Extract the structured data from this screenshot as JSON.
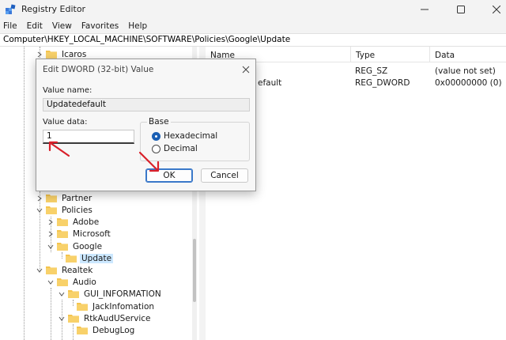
{
  "window": {
    "title": "Registry Editor",
    "icon": "registry-icon"
  },
  "menu": [
    "File",
    "Edit",
    "View",
    "Favorites",
    "Help"
  ],
  "address": "Computer\\HKEY_LOCAL_MACHINE\\SOFTWARE\\Policies\\Google\\Update",
  "tree": {
    "items": [
      {
        "label": "Icaros",
        "expander": "right",
        "selected": false
      },
      {
        "label": "Partner",
        "expander": "right",
        "selected": false
      },
      {
        "label": "Policies",
        "expander": "down",
        "selected": false
      },
      {
        "label": "Adobe",
        "expander": "right",
        "selected": false
      },
      {
        "label": "Microsoft",
        "expander": "right",
        "selected": false
      },
      {
        "label": "Google",
        "expander": "down",
        "selected": false
      },
      {
        "label": "Update",
        "expander": "none",
        "selected": true
      },
      {
        "label": "Realtek",
        "expander": "down",
        "selected": false
      },
      {
        "label": "Audio",
        "expander": "down",
        "selected": false
      },
      {
        "label": "GUI_INFORMATION",
        "expander": "down",
        "selected": false
      },
      {
        "label": "JackInfomation",
        "expander": "none",
        "selected": false
      },
      {
        "label": "RtkAudUService",
        "expander": "down",
        "selected": false
      },
      {
        "label": "DebugLog",
        "expander": "none",
        "selected": false
      }
    ]
  },
  "list": {
    "columns": [
      "Name",
      "Type",
      "Data"
    ],
    "rows": [
      {
        "name": "",
        "type": "REG_SZ",
        "data": "(value not set)"
      },
      {
        "name": "efault",
        "type": "REG_DWORD",
        "data": "0x00000000 (0)"
      }
    ]
  },
  "dialog": {
    "title": "Edit DWORD (32-bit) Value",
    "value_name_label": "Value name:",
    "value_name": "Updatedefault",
    "value_data_label": "Value data:",
    "value_data": "1",
    "base_label": "Base",
    "hex_label": "Hexadecimal",
    "dec_label": "Decimal",
    "ok_label": "OK",
    "cancel_label": "Cancel"
  },
  "colors": {
    "annotation_arrow": "#d9202a",
    "folder": "#f4c44e",
    "selection": "#cce8ff",
    "accent": "#1a5fb4"
  }
}
